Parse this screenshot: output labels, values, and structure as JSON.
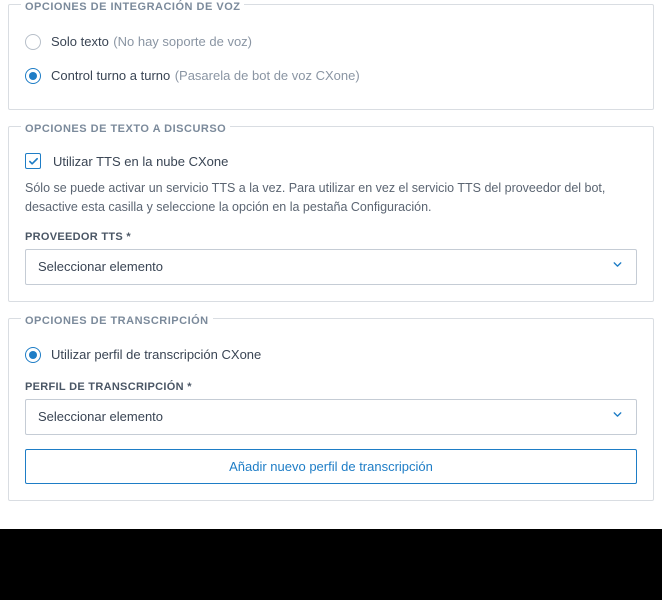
{
  "voice_integration": {
    "title": "OPCIONES DE INTEGRACIÓN DE VOZ",
    "options": [
      {
        "label": "Solo texto",
        "hint": "(No hay soporte de voz)",
        "checked": false
      },
      {
        "label": "Control turno a turno",
        "hint": "(Pasarela de bot de voz CXone)",
        "checked": true
      }
    ]
  },
  "tts": {
    "title": "OPCIONES DE TEXTO A DISCURSO",
    "checkbox_label": "Utilizar TTS en la nube CXone",
    "checkbox_checked": true,
    "help_text": "Sólo se puede activar un servicio TTS a la vez. Para utilizar en vez el servicio TTS del proveedor del bot, desactive esta casilla y seleccione la opción en la pestaña Configuración.",
    "provider_label": "PROVEEDOR TTS *",
    "provider_value": "Seleccionar elemento"
  },
  "transcription": {
    "title": "OPCIONES DE TRANSCRIPCIÓN",
    "radio_label": "Utilizar perfil de transcripción CXone",
    "radio_checked": true,
    "profile_label": "PERFIL DE TRANSCRIPCIÓN *",
    "profile_value": "Seleccionar elemento",
    "add_button": "Añadir nuevo perfil de transcripción"
  }
}
